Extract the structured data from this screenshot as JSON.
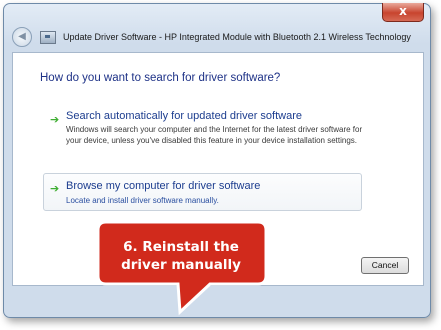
{
  "window": {
    "title": "Update Driver Software - HP Integrated Module with Bluetooth 2.1 Wireless Technology",
    "close_label": "x",
    "back_label": "◀"
  },
  "dialog": {
    "heading": "How do you want to search for driver software?",
    "options": [
      {
        "arrow": "➔",
        "title": "Search automatically for updated driver software",
        "description": "Windows will search your computer and the Internet for the latest driver software for your device, unless you've disabled this feature in your device installation settings."
      },
      {
        "arrow": "➔",
        "title": "Browse my computer for driver software",
        "description": "Locate and install driver software manually."
      }
    ],
    "cancel_label": "Cancel"
  },
  "callout": {
    "line1": "6. Reinstall the",
    "line2": "driver manually"
  },
  "colors": {
    "heading": "#1e3287",
    "arrow": "#3fae32",
    "callout_fill": "#d12a1c"
  }
}
